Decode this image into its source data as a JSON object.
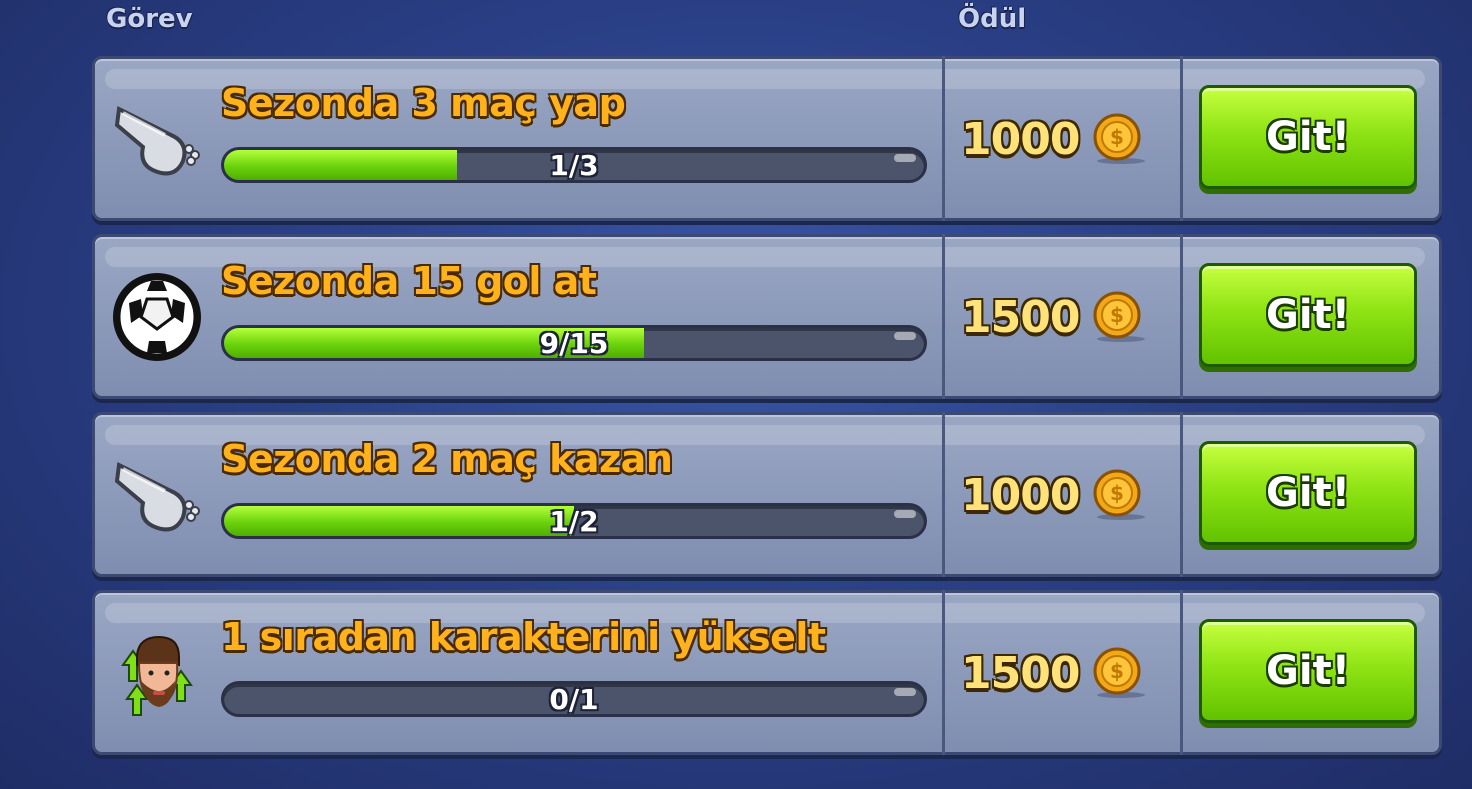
{
  "headers": {
    "task": "Görev",
    "reward": "Ödül"
  },
  "quests": [
    {
      "icon": "whistle-icon",
      "title": "Sezonda 3 maç yap",
      "progress_text": "1/3",
      "progress": 0.333,
      "reward": "1000",
      "button": "Git!"
    },
    {
      "icon": "soccer-ball-icon",
      "title": "Sezonda 15 gol at",
      "progress_text": "9/15",
      "progress": 0.6,
      "reward": "1500",
      "button": "Git!"
    },
    {
      "icon": "whistle-icon",
      "title": "Sezonda 2 maç kazan",
      "progress_text": "1/2",
      "progress": 0.5,
      "reward": "1000",
      "button": "Git!"
    },
    {
      "icon": "character-upgrade-icon",
      "title": "1 sıradan karakterini yükselt",
      "progress_text": "0/1",
      "progress": 0.0,
      "reward": "1500",
      "button": "Git!"
    }
  ],
  "colors": {
    "title": "#ffb21c",
    "progress_fill": "#7ee01a",
    "button": "#8fe414",
    "coin": "#f2a818"
  }
}
